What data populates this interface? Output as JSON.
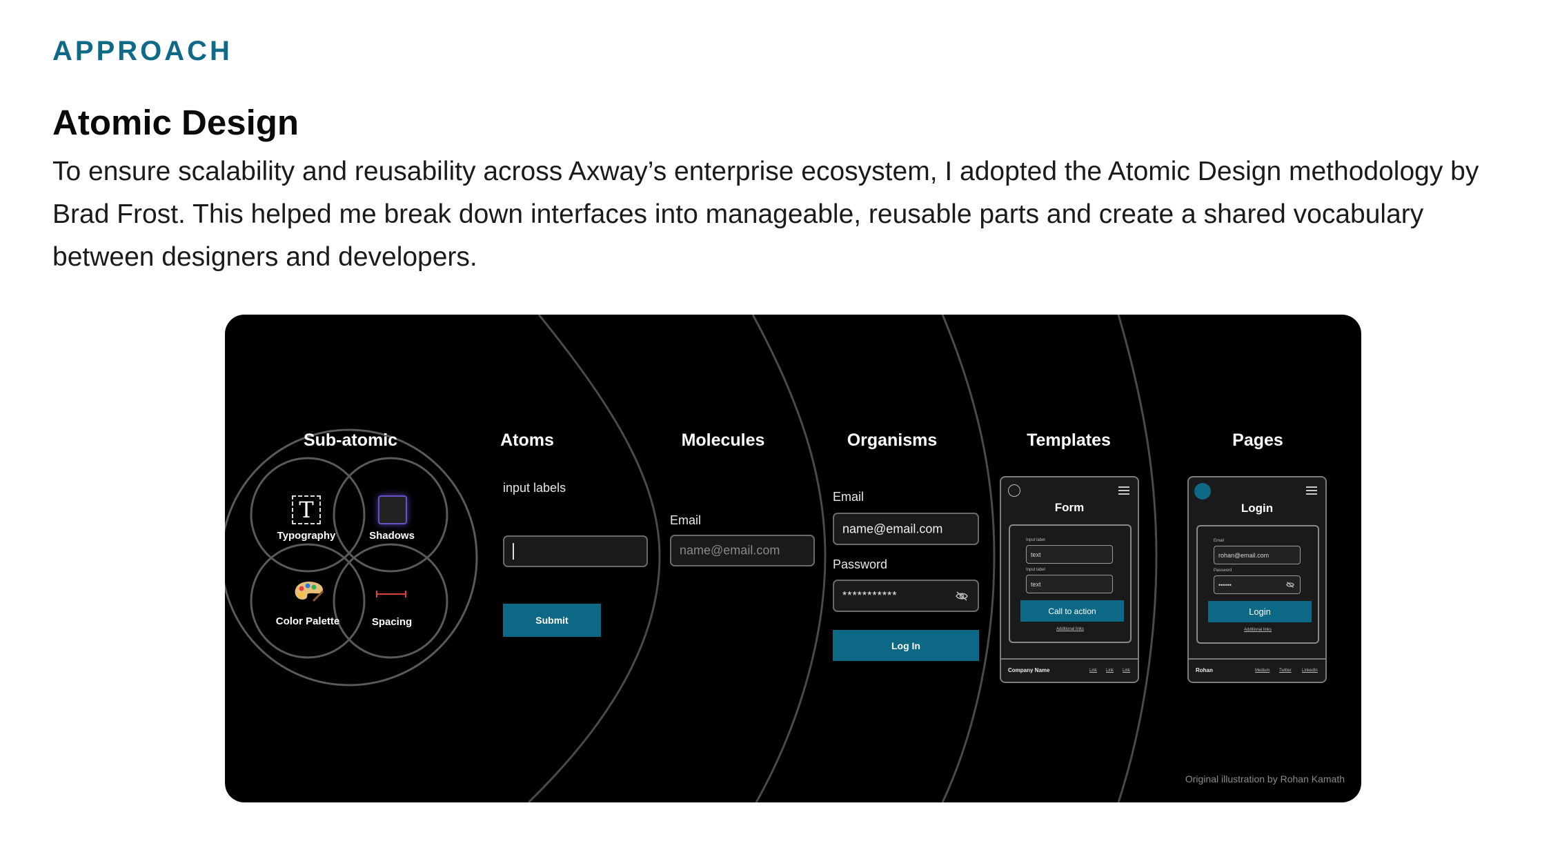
{
  "header": {
    "eyebrow": "APPROACH",
    "title": "Atomic Design",
    "body": "To ensure scalability and reusability across Axway’s enterprise ecosystem, I adopted the Atomic Design methodology by Brad Frost. This helped me break down interfaces into manageable, reusable parts and create a shared vocabulary between designers and developers."
  },
  "illustration": {
    "columns": {
      "subatomic": "Sub-atomic",
      "atoms": "Atoms",
      "molecules": "Molecules",
      "organisms": "Organisms",
      "templates": "Templates",
      "pages": "Pages"
    },
    "subatomic": {
      "typography": "Typography",
      "typography_glyph": "T",
      "shadows": "Shadows",
      "color_palette": "Color Palette",
      "spacing": "Spacing"
    },
    "atoms": {
      "input_labels": "input labels",
      "submit": "Submit"
    },
    "molecules": {
      "email_label": "Email",
      "email_placeholder": "name@email.com"
    },
    "organisms": {
      "email_label": "Email",
      "email_value": "name@email.com",
      "password_label": "Password",
      "password_value": "***********",
      "login": "Log In"
    },
    "templates": {
      "heading": "Form",
      "label1": "Input label",
      "field1": "text",
      "label2": "Input label",
      "field2": "text",
      "cta": "Call to action",
      "links": "Additional links",
      "footer_name": "Company Name",
      "footer_link1": "Link",
      "footer_link2": "Link",
      "footer_link3": "Link"
    },
    "pages": {
      "heading": "Login",
      "label1": "Email",
      "field1": "rohan@email.com",
      "label2": "Password",
      "field2": "••••••",
      "cta": "Login",
      "links": "Additional links",
      "footer_name": "Rohan",
      "footer_link1": "Medium",
      "footer_link2": "Twitter",
      "footer_link3": "LinkedIn"
    },
    "credit": "Original illustration by Rohan Kamath",
    "colors": {
      "accent": "#0d6885",
      "background": "#000000",
      "eyebrow": "#0f6a88",
      "shadow_box": "#6a4fc9",
      "spacing_marker": "#e0403a"
    }
  }
}
